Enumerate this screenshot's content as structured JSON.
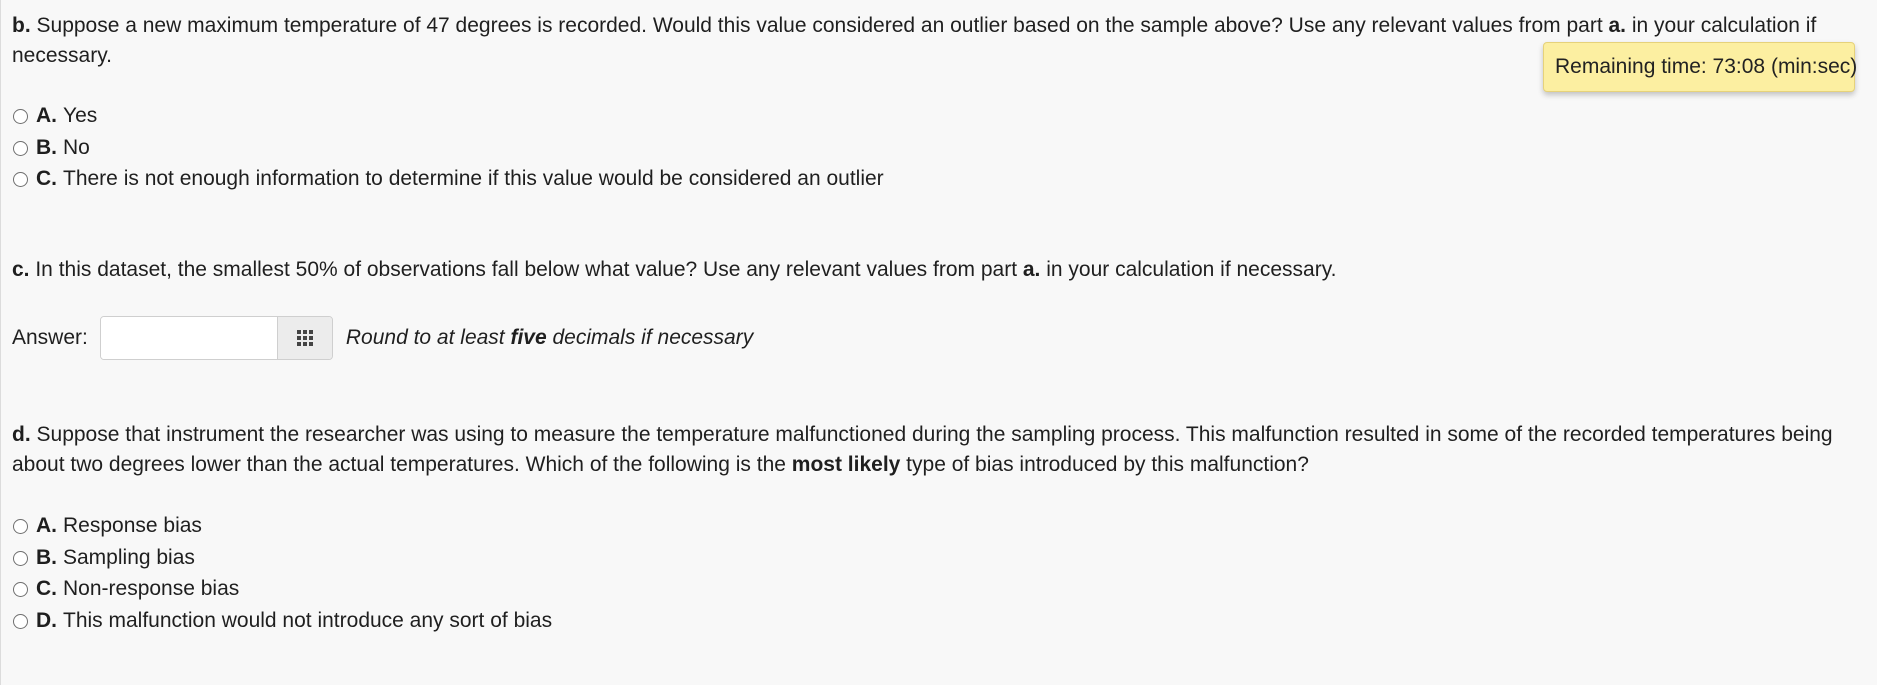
{
  "timer": {
    "text": "Remaining time: 73:08 (min:sec)"
  },
  "part_b": {
    "label": "b.",
    "text1": " Suppose a new maximum temperature of 47 degrees is recorded. Would this value considered an outlier based on the sample above? Use any relevant values from part ",
    "ref": "a.",
    "text2": " in your calculation if necessary.",
    "options": [
      {
        "letter": "A.",
        "text": "Yes"
      },
      {
        "letter": "B.",
        "text": "No"
      },
      {
        "letter": "C.",
        "text": "There is not enough information to determine if this value would be considered an outlier"
      }
    ]
  },
  "part_c": {
    "label": "c.",
    "text1": " In this dataset, the smallest 50% of observations fall below what value? Use any relevant values from part ",
    "ref": "a.",
    "text2": " in your calculation if necessary.",
    "answer_label": "Answer:",
    "answer_value": "",
    "hint_before": "Round to at least ",
    "hint_bold": "five",
    "hint_after": " decimals if necessary"
  },
  "part_d": {
    "label": "d.",
    "text1": " Suppose that instrument the researcher was using to measure the temperature malfunctioned during the sampling process. This malfunction resulted in some of the recorded temperatures being about two degrees lower than the actual temperatures. Which of the following is the ",
    "bold": "most likely",
    "text2": " type of bias introduced by this malfunction?",
    "options": [
      {
        "letter": "A.",
        "text": "Response bias"
      },
      {
        "letter": "B.",
        "text": "Sampling bias"
      },
      {
        "letter": "C.",
        "text": "Non-response bias"
      },
      {
        "letter": "D.",
        "text": "This malfunction would not introduce any sort of bias"
      }
    ]
  }
}
